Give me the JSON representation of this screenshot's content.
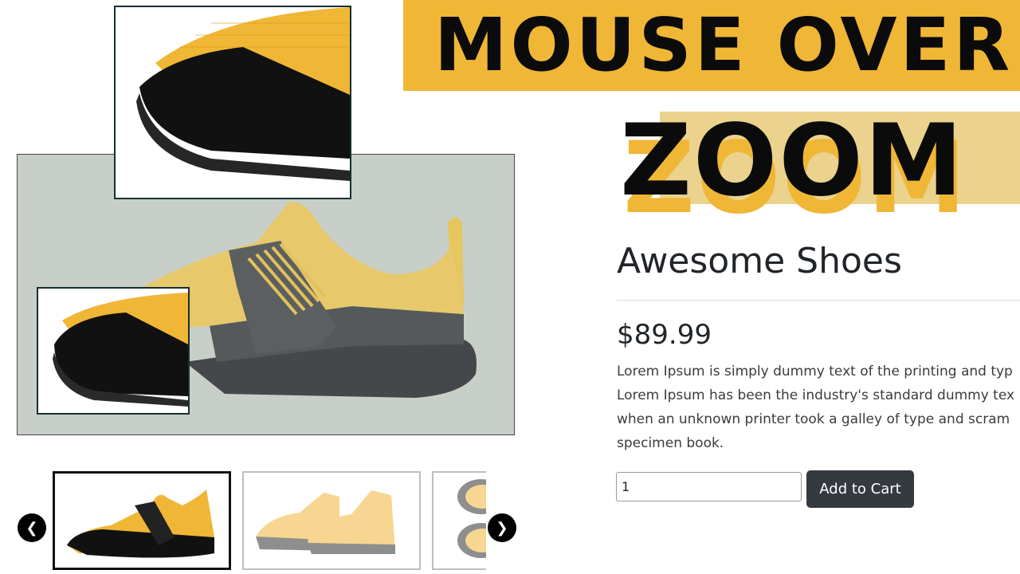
{
  "banner": {
    "line1": "MOUSE OVER",
    "line2": "ZOOM"
  },
  "product": {
    "title": "Awesome Shoes",
    "price": "$89.99",
    "description_lines": [
      "Lorem Ipsum is simply dummy text of the printing and typ",
      "Lorem Ipsum has been the industry's standard dummy tex",
      "when an unknown printer took a galley of type and scram",
      "specimen book."
    ],
    "quantity": "1",
    "add_to_cart_label": "Add to Cart"
  },
  "gallery": {
    "main_image": "shoe-side-view",
    "zoom_lens": "zoom-lens-toe",
    "zoom_result": "zoomed-toe-detail",
    "thumbnails": [
      "shoe-side-thumb",
      "shoe-pair-thumb",
      "shoe-soles-thumb"
    ],
    "prev_icon": "chevron-left-icon",
    "next_icon": "chevron-right-icon"
  },
  "colors": {
    "accent_yellow": "#f0b636",
    "light_yellow": "#ebd38e",
    "button_dark": "#343a40",
    "image_background": "#c8cfc8"
  }
}
